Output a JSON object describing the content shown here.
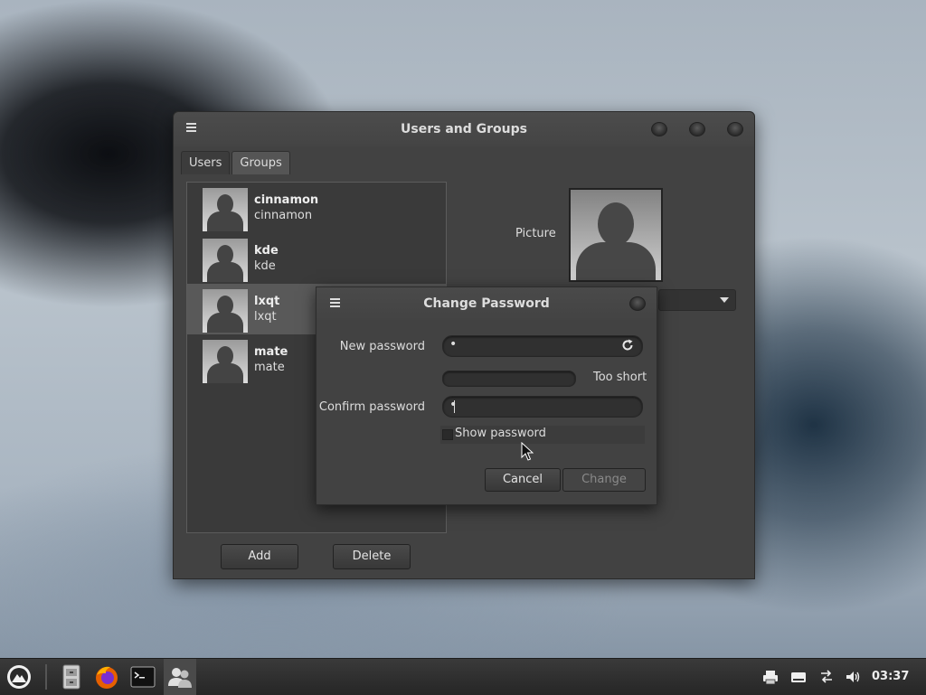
{
  "window": {
    "title": "Users and Groups",
    "tabs": [
      {
        "label": "Users",
        "active": true
      },
      {
        "label": "Groups",
        "active": false
      }
    ],
    "users": [
      {
        "name": "cinnamon",
        "login": "cinnamon",
        "selected": false
      },
      {
        "name": "kde",
        "login": "kde",
        "selected": false
      },
      {
        "name": "lxqt",
        "login": "lxqt",
        "selected": true
      },
      {
        "name": "mate",
        "login": "mate",
        "selected": false
      }
    ],
    "picture_label": "Picture",
    "add_label": "Add",
    "delete_label": "Delete"
  },
  "dialog": {
    "title": "Change Password",
    "new_password_label": "New password",
    "new_password_value": "•",
    "strength_text": "Too short",
    "confirm_password_label": "Confirm password",
    "confirm_password_value": "•",
    "show_password_label": "Show password",
    "cancel_label": "Cancel",
    "change_label": "Change"
  },
  "taskbar": {
    "clock": "03:37",
    "apps": [
      "menu-icon",
      "file-manager-icon",
      "firefox-icon",
      "terminal-icon",
      "users-groups-icon"
    ],
    "tray": [
      "printer-icon",
      "keyboard-icon",
      "network-icon",
      "volume-icon"
    ],
    "colors": {
      "accent": "#595959",
      "panel": "#424242"
    }
  }
}
